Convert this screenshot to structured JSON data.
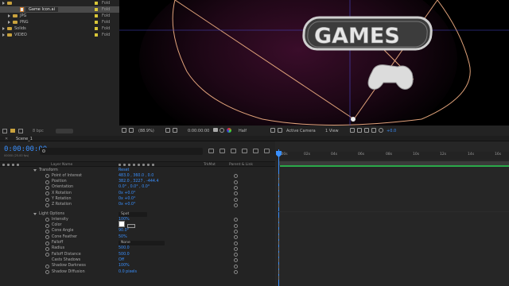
{
  "project": {
    "items": [
      {
        "name": "",
        "kind": "folder",
        "type": "Fold"
      },
      {
        "name": "Game Icon.ai",
        "kind": "file",
        "type": "Fold"
      },
      {
        "name": "JPG",
        "kind": "folder",
        "type": "Fold"
      },
      {
        "name": "PNG",
        "kind": "folder",
        "type": "Fold"
      },
      {
        "name": "Solids",
        "kind": "folder",
        "type": "Fold"
      },
      {
        "name": "VIDEO",
        "kind": "folder",
        "type": "Fold"
      }
    ],
    "bpc": "8 bpc"
  },
  "viewer": {
    "title_art": "GAMES",
    "zoom": "(88.9%)",
    "timecode": "0:00:00:00",
    "resolution": "Half",
    "camera": "Active Camera",
    "views": "1 View",
    "exposure": "+0.0"
  },
  "timeline": {
    "tab": "Scene_1",
    "timecode": "0:00:00:00",
    "fps": "00000 (25.00 fps)",
    "columns": {
      "layer_name": "Layer Name",
      "parent": "Parent & Link",
      "tracker": "TrkMat"
    },
    "ruler": [
      ":00s",
      "02s",
      "04s",
      "06s",
      "08s",
      "10s",
      "12s",
      "14s",
      "16s"
    ],
    "rows": [
      {
        "name": "Transform",
        "value": "Reset",
        "indent": 1,
        "twirl": true
      },
      {
        "name": "Point of Interest",
        "value": "483.0 , 360.0 , 0.0",
        "indent": 2
      },
      {
        "name": "Position",
        "value": "382.0 , 3227 , -444.4",
        "indent": 2
      },
      {
        "name": "Orientation",
        "value": "0.0° , 0.0° , 0.0°",
        "indent": 2
      },
      {
        "name": "X Rotation",
        "value": "0x +0.0°",
        "indent": 2
      },
      {
        "name": "Y Rotation",
        "value": "0x +0.0°",
        "indent": 2
      },
      {
        "name": "Z Rotation",
        "value": "0x +0.0°",
        "indent": 2
      },
      {
        "name": "Light Options",
        "value": "Spot",
        "indent": 1,
        "twirl": true,
        "select": true
      },
      {
        "name": "Intensity",
        "value": "100%",
        "indent": 2
      },
      {
        "name": "Color",
        "value": "",
        "indent": 2,
        "color": true
      },
      {
        "name": "Cone Angle",
        "value": "90.0°",
        "indent": 2
      },
      {
        "name": "Cone Feather",
        "value": "50%",
        "indent": 2
      },
      {
        "name": "Falloff",
        "value": "None",
        "indent": 2,
        "select": true,
        "wide": true
      },
      {
        "name": "Radius",
        "value": "500.0",
        "indent": 2
      },
      {
        "name": "Falloff Distance",
        "value": "500.0",
        "indent": 2
      },
      {
        "name": "Casts Shadows",
        "value": "Off",
        "indent": 2
      },
      {
        "name": "Shadow Darkness",
        "value": "100%",
        "indent": 2
      },
      {
        "name": "Shadow Diffusion",
        "value": "0.0 pixels",
        "indent": 2
      }
    ]
  },
  "colors": {
    "accent": "#3a90ff",
    "folder": "#c9a23d",
    "label": "#d8c638",
    "layer_bar": "#2aa94a",
    "light_wire": "#e0a27a"
  }
}
